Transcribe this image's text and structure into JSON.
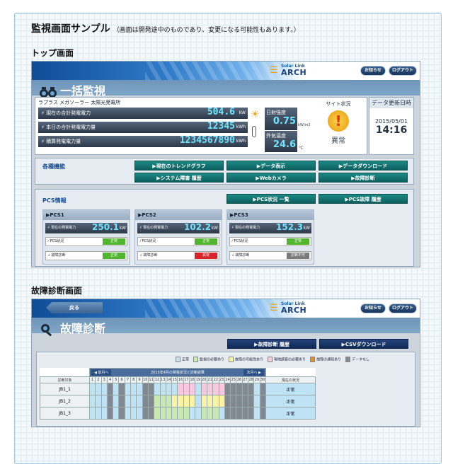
{
  "page": {
    "title": "監視画面サンプル",
    "note": "（画面は開発途中のものであり、変更になる可能性もあります。）",
    "section_top": "トップ画面",
    "section_fault": "故障診断画面"
  },
  "header": {
    "logo_sub": "Solar Link",
    "logo_main": "ARCH",
    "notice_label": "お知らせ",
    "logout_label": "ログアウト",
    "back_label": "戻る"
  },
  "top": {
    "heading": "一括監視",
    "site_name": "ラプラス メガソーラー 太陽光発電所",
    "rows": [
      {
        "label": "現在の合計発電電力",
        "value": "504.6",
        "unit": "kW"
      },
      {
        "label": "本日の合計発電電力量",
        "value": "12345",
        "unit": "kWh"
      },
      {
        "label": "積算発電電力量",
        "value": "1234567890",
        "unit": "kWh"
      }
    ],
    "irradiance": {
      "label": "日射強度",
      "value": "0.75",
      "unit": "kW/m2"
    },
    "temperature": {
      "label": "外気温度",
      "value": "24.6",
      "unit": "℃"
    },
    "site_status": {
      "label": "サイト状況",
      "value": "異常"
    },
    "update": {
      "label": "データ更新日時",
      "date": "2015/05/01",
      "time": "14:16"
    },
    "functions": {
      "label": "各種機能",
      "buttons": [
        "▶現在のトレンドグラフ",
        "▶データ表示",
        "▶データダウンロード",
        "▶システム障害 履歴",
        "▶Webカメラ",
        "▶故障診断"
      ]
    },
    "pcs": {
      "label": "PCS情報",
      "btn_list": "▶PCS状況 一覧",
      "btn_history": "▶PCS故障 履歴",
      "power_label": "現在の発電電力",
      "status_label": "PCS状況",
      "diag_label": "故障診断",
      "units": [
        {
          "name": "▶PCS1",
          "value": "250.1",
          "unit": "kW",
          "status": "正常",
          "diag": "正常",
          "diag_color": "#4fb62d"
        },
        {
          "name": "▶PCS2",
          "value": "102.2",
          "unit": "kW",
          "status": "正常",
          "diag": "異常",
          "diag_color": "#d8232a"
        },
        {
          "name": "▶PCS3",
          "value": "152.3",
          "unit": "kW",
          "status": "正常",
          "diag": "診断不可",
          "diag_color": "#7a7a7a"
        }
      ]
    }
  },
  "fault": {
    "heading": "故障診断",
    "btn_history": "▶故障診断 履歴",
    "btn_csv": "▶CSVダウンロード",
    "legend": [
      {
        "label": "正常",
        "color": "#bfe3f5"
      },
      {
        "label": "監視の必要あり",
        "color": "#c9e9b4"
      },
      {
        "label": "故障の可能性あり",
        "color": "#faf3a6"
      },
      {
        "label": "現地調査の必要あり",
        "color": "#f7c8e0"
      },
      {
        "label": "故障の通知あり",
        "color": "#f08a1e"
      },
      {
        "label": "データなし",
        "color": "#808890"
      }
    ],
    "prev": "◀ 前月へ",
    "next": "次月へ ▶",
    "table_title": "2015年4月の発電状況と診断結果",
    "col_target": "診断対象",
    "col_status": "現在の状況",
    "days": [
      "1",
      "2",
      "3",
      "4",
      "5",
      "6",
      "7",
      "8",
      "9",
      "10",
      "11",
      "12",
      "13",
      "14",
      "15",
      "16",
      "17",
      "18",
      "19",
      "20",
      "21",
      "22",
      "23",
      "24",
      "25",
      "26",
      "27",
      "28",
      "29",
      "30"
    ],
    "rows": [
      {
        "name": "JB1_1",
        "status": "正常",
        "cells": "nnnxnxnnnxxnnnnpppnppppxxxxxnx"
      },
      {
        "name": "JB1_2",
        "status": "正常",
        "cells": "nnnxnxnnnxxgggyyyynyyyyxxxxxnx"
      },
      {
        "name": "JB1_3",
        "status": "正常",
        "cells": "nnnxnxnnnxxggggggnngggnxxxxxnx"
      }
    ]
  }
}
